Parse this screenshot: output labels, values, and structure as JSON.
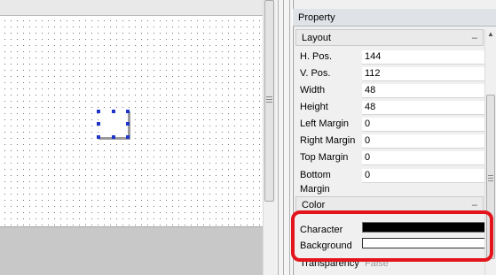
{
  "property_panel": {
    "title": "Property",
    "layout_section": {
      "header": "Layout",
      "collapse_symbol": "–",
      "rows": [
        {
          "label": "H. Pos.",
          "value": "144"
        },
        {
          "label": "V. Pos.",
          "value": "112"
        },
        {
          "label": "Width",
          "value": "48"
        },
        {
          "label": "Height",
          "value": "48"
        },
        {
          "label": "Left Margin",
          "value": "0"
        },
        {
          "label": "Right Margin",
          "value": "0"
        },
        {
          "label": "Top Margin",
          "value": "0"
        },
        {
          "label": "Bottom Margin",
          "value": "0"
        }
      ]
    },
    "color_section": {
      "header": "Color",
      "collapse_symbol": "–",
      "character_label": "Character",
      "background_label": "Background",
      "transparency_label": "Transparency",
      "transparency_value": "False",
      "character_color": "#000000",
      "background_color": "#ffffff"
    }
  },
  "icons": {
    "scroll_up": "scroll-up-arrow-icon",
    "scroll_grip": "scroll-grip-icon"
  },
  "colors": {
    "highlight": "#e3141b",
    "selection_handle": "#1f35c9"
  }
}
